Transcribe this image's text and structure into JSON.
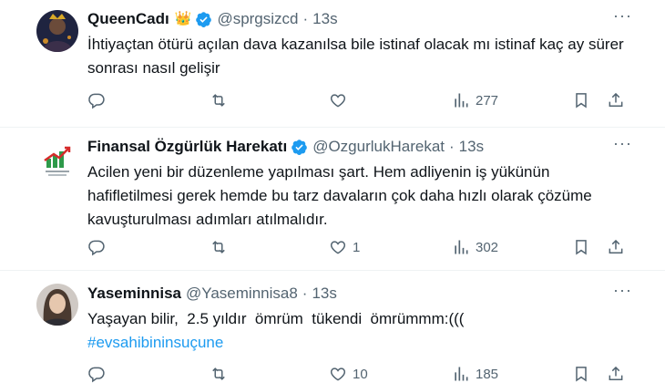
{
  "tweets": [
    {
      "name": "QueenCadı",
      "badge": "👑",
      "handle": "@sprgsizcd",
      "sep": "·",
      "time": "13s",
      "text": "İhtiyaçtan ötürü açılan dava kazanılsa bile istinaf olacak mı istinaf kaç ay sürer sonrası nasıl gelişir",
      "hashtag": "",
      "replies": "",
      "retweets": "",
      "likes": "",
      "views": "277"
    },
    {
      "name": "Finansal Özgürlük Harekatı",
      "handle": "@OzgurlukHarekat",
      "sep": "·",
      "time": "13s",
      "text": "Acilen yeni bir düzenleme yapılması şart. Hem adliyenin iş yükünün hafifletilmesi gerek hemde bu tarz davaların çok daha hızlı olarak çözüme kavuşturulması adımları atılmalıdır.",
      "hashtag": "",
      "replies": "",
      "retweets": "",
      "likes": "1",
      "views": "302"
    },
    {
      "name": "Yaseminnisa",
      "handle": "@Yaseminnisa8",
      "sep": "·",
      "time": "13s",
      "text": "Yaşayan bilir,  2.5 yıldır  ömrüm  tükendi  ömrümmm:(((",
      "hashtag": "#evsahibininsuçune",
      "replies": "",
      "retweets": "",
      "likes": "10",
      "views": "185"
    }
  ],
  "colors": {
    "verified": "#1d9bf0",
    "muted": "#536471",
    "text": "#0f1419",
    "hashtag": "#1d9bf0",
    "divider": "#eff3f4"
  },
  "icons": {
    "reply": "reply-icon",
    "retweet": "retweet-icon",
    "like": "heart-icon",
    "views": "views-chart-icon",
    "bookmark": "bookmark-icon",
    "share": "share-icon",
    "verified": "verified-badge-icon",
    "more": "more-dots-icon"
  }
}
